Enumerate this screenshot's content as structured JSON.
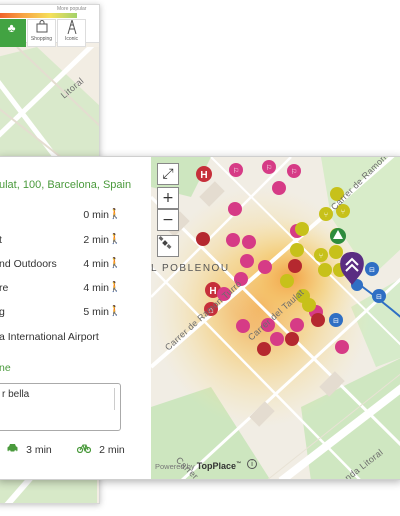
{
  "back_card": {
    "more_popular_label": "More popular",
    "categories": [
      {
        "label": "",
        "icon": "tree-icon"
      },
      {
        "label": "Shopping",
        "icon": "shopping-bag-icon"
      },
      {
        "label": "Iconic",
        "icon": "eiffel-tower-icon"
      }
    ],
    "street_label": "Litoral"
  },
  "panel": {
    "address": "ulat, 100, Barcelona, Spain",
    "nearby": [
      {
        "name": "",
        "time": "0 min"
      },
      {
        "name": "t",
        "time": "2 min"
      },
      {
        "name": "nd Outdoors",
        "time": "4 min"
      },
      {
        "name": "re",
        "time": "4 min"
      },
      {
        "name": "g",
        "time": "5 min"
      }
    ],
    "airport": "a International Airport",
    "note_label": "ne",
    "note_text": "r bella",
    "transport": [
      {
        "icon": "car-icon",
        "time": "3 min"
      },
      {
        "icon": "bicycle-icon",
        "time": "2 min"
      }
    ]
  },
  "map": {
    "controls": {
      "fullscreen": "⤢",
      "zoom_in": "+",
      "zoom_out": "−",
      "satellite": "satellite-icon"
    },
    "labels": {
      "district": "L POBLENOU",
      "street1": "Carrer de Ramon Turró",
      "street2": "Carrer del Taulat",
      "street3": "Carrer del Taulat",
      "street4": "Carrer de Ramon",
      "street5": "nda Litoral"
    },
    "powered_by": "Powered by",
    "brand": "TopPlace",
    "brand_tm": "™",
    "info": "i",
    "colors": {
      "hotel": "#c62f3a",
      "shopping": "#d63b86",
      "food": "#c7c11a",
      "park": "#2e8b3d",
      "transit": "#2f6fc4",
      "marker": "#5a2d82"
    }
  }
}
